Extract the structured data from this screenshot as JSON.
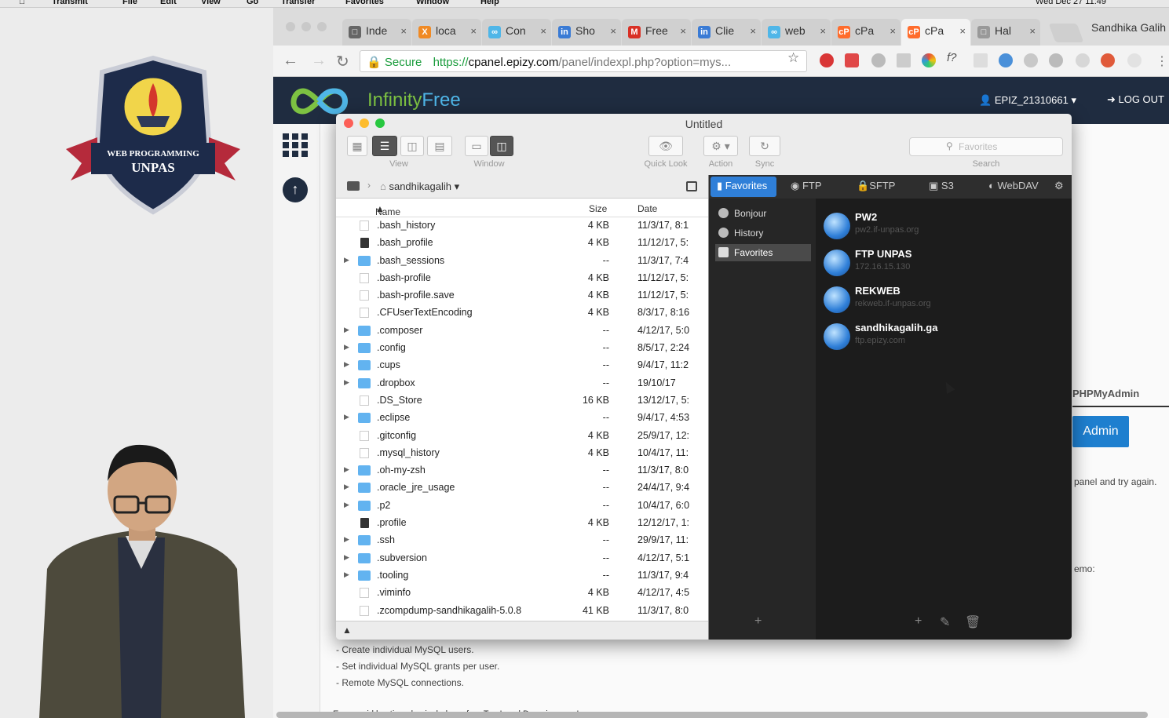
{
  "menubar": {
    "items": [
      "Transmit",
      "File",
      "Edit",
      "View",
      "Go",
      "Transfer",
      "Favorites",
      "Window",
      "Help"
    ],
    "clock": "Wed Dec 27 11:49"
  },
  "badge": {
    "line1": "WEB PROGRAMMING",
    "line2": "UNPAS"
  },
  "chrome": {
    "tabs": [
      {
        "icon": "tab-generic-icon",
        "label": "Inde"
      },
      {
        "icon": "xampp-icon",
        "label": "loca"
      },
      {
        "icon": "infinity-icon",
        "label": "Con"
      },
      {
        "icon": "infinity-logo-icon",
        "label": "Sho"
      },
      {
        "icon": "gmail-icon",
        "label": "Free"
      },
      {
        "icon": "infinity-logo-icon",
        "label": "Clie"
      },
      {
        "icon": "infinity-icon",
        "label": "web"
      },
      {
        "icon": "cpanel-icon",
        "label": "cPa"
      },
      {
        "icon": "cpanel-icon",
        "label": "cPa"
      },
      {
        "icon": "document-icon",
        "label": "Hal"
      }
    ],
    "profile": "Sandhika Galih",
    "secure_label": "Secure",
    "url_scheme": "https://",
    "url_host": "cpanel.epizy.com",
    "url_path": "/panel/indexpl.php?option=mys...",
    "colors": {
      "secure": "#1a9c3c"
    }
  },
  "infinityfree": {
    "brand_a": "Infinity",
    "brand_b": "Free",
    "user": "EPIZ_21310661",
    "logout": "LOG OUT",
    "colors": {
      "header": "#1f2c40",
      "brand_green": "#7dc242",
      "brand_blue": "#4fb6e8"
    }
  },
  "cpanel": {
    "pma_tab": "PHPMyAdmin",
    "admin_button": "Admin",
    "error_text": "panel and try again.",
    "memo_text": "emo:",
    "features": [
      "- Create individual MySQL users.",
      "- Set individual MySQL grants per user.",
      "- Remote MySQL connections."
    ],
    "footer": "Every paid hosting plan includes a free Top Level Domain name!"
  },
  "transmit": {
    "title": "Untitled",
    "view_label": "View",
    "window_label": "Window",
    "quicklook_label": "Quick Look",
    "action_label": "Action",
    "sync_label": "Sync",
    "search_placeholder": "Favorites",
    "search_label": "Search",
    "local_path": "sandhikagalih",
    "columns": {
      "name": "Name",
      "size": "Size",
      "date": "Date"
    },
    "files": [
      {
        "name": ".bash_history",
        "size": "4 KB",
        "date": "11/3/17, 8:1",
        "type": "doc",
        "expandable": false
      },
      {
        "name": ".bash_profile",
        "size": "4 KB",
        "date": "11/12/17, 5:",
        "type": "exec",
        "expandable": false
      },
      {
        "name": ".bash_sessions",
        "size": "--",
        "date": "11/3/17, 7:4",
        "type": "folder",
        "expandable": true
      },
      {
        "name": ".bash-profile",
        "size": "4 KB",
        "date": "11/12/17, 5:",
        "type": "doc",
        "expandable": false
      },
      {
        "name": ".bash-profile.save",
        "size": "4 KB",
        "date": "11/12/17, 5:",
        "type": "doc",
        "expandable": false
      },
      {
        "name": ".CFUserTextEncoding",
        "size": "4 KB",
        "date": "8/3/17, 8:16",
        "type": "doc",
        "expandable": false
      },
      {
        "name": ".composer",
        "size": "--",
        "date": "4/12/17, 5:0",
        "type": "folder",
        "expandable": true
      },
      {
        "name": ".config",
        "size": "--",
        "date": "8/5/17, 2:24",
        "type": "folder",
        "expandable": true
      },
      {
        "name": ".cups",
        "size": "--",
        "date": "9/4/17, 11:2",
        "type": "folder",
        "expandable": true
      },
      {
        "name": ".dropbox",
        "size": "--",
        "date": "19/10/17",
        "type": "folder",
        "expandable": true
      },
      {
        "name": ".DS_Store",
        "size": "16 KB",
        "date": "13/12/17, 5:",
        "type": "doc",
        "expandable": false
      },
      {
        "name": ".eclipse",
        "size": "--",
        "date": "9/4/17, 4:53",
        "type": "folder",
        "expandable": true
      },
      {
        "name": ".gitconfig",
        "size": "4 KB",
        "date": "25/9/17, 12:",
        "type": "doc",
        "expandable": false
      },
      {
        "name": ".mysql_history",
        "size": "4 KB",
        "date": "10/4/17, 11:",
        "type": "doc",
        "expandable": false
      },
      {
        "name": ".oh-my-zsh",
        "size": "--",
        "date": "11/3/17, 8:0",
        "type": "folder",
        "expandable": true
      },
      {
        "name": ".oracle_jre_usage",
        "size": "--",
        "date": "24/4/17, 9:4",
        "type": "folder",
        "expandable": true
      },
      {
        "name": ".p2",
        "size": "--",
        "date": "10/4/17, 6:0",
        "type": "folder",
        "expandable": true
      },
      {
        "name": ".profile",
        "size": "4 KB",
        "date": "12/12/17, 1:",
        "type": "exec",
        "expandable": false
      },
      {
        "name": ".ssh",
        "size": "--",
        "date": "29/9/17, 11:",
        "type": "folder",
        "expandable": true
      },
      {
        "name": ".subversion",
        "size": "--",
        "date": "4/12/17, 5:1",
        "type": "folder",
        "expandable": true
      },
      {
        "name": ".tooling",
        "size": "--",
        "date": "11/3/17, 9:4",
        "type": "folder",
        "expandable": true
      },
      {
        "name": ".viminfo",
        "size": "4 KB",
        "date": "4/12/17, 4:5",
        "type": "doc",
        "expandable": false
      },
      {
        "name": ".zcompdump-sandhikagalih-5.0.8",
        "size": "41 KB",
        "date": "11/3/17, 8:0",
        "type": "doc",
        "expandable": false
      }
    ],
    "remote_tabs": [
      "Favorites",
      "FTP",
      "SFTP",
      "S3",
      "WebDAV"
    ],
    "sidebar": [
      "Bonjour",
      "History",
      "Favorites"
    ],
    "favorites": [
      {
        "name": "PW2",
        "host": "pw2.if-unpas.org"
      },
      {
        "name": "FTP UNPAS",
        "host": "172.16.15.130"
      },
      {
        "name": "REKWEB",
        "host": "rekweb.if-unpas.org"
      },
      {
        "name": "sandhikagalih.ga",
        "host": "ftp.epizy.com"
      }
    ],
    "colors": {
      "accent": "#2f7fd8",
      "remote_bg": "#1c1c1c",
      "folder": "#62b3f0"
    }
  }
}
